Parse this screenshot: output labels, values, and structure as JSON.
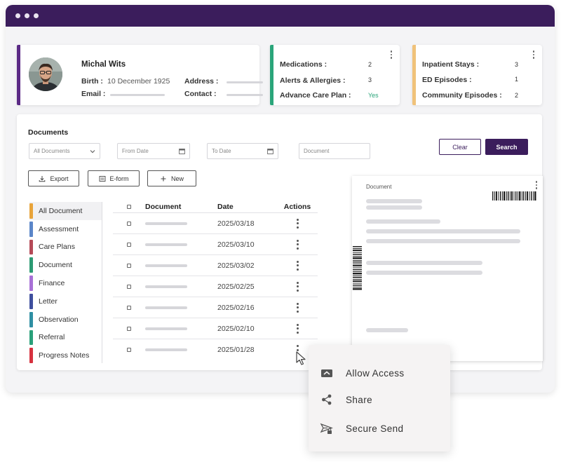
{
  "patient": {
    "name": "Michal Wits",
    "birth_label": "Birth :",
    "birth_value": "10 December 1925",
    "email_label": "Email :",
    "address_label": "Address :",
    "contact_label": "Contact :"
  },
  "clinical": {
    "rows": [
      {
        "label": "Medications :",
        "value": "2"
      },
      {
        "label": "Alerts & Allergies :",
        "value": "3"
      },
      {
        "label": "Advance Care Plan :",
        "value": "Yes"
      }
    ]
  },
  "episodes": {
    "rows": [
      {
        "label": "Inpatient Stays :",
        "value": "3"
      },
      {
        "label": "ED Episodes :",
        "value": "1"
      },
      {
        "label": "Community Episodes :",
        "value": "2"
      }
    ]
  },
  "documents": {
    "title": "Documents",
    "filter_select": "All Documents",
    "from_date_placeholder": "From Date",
    "to_date_placeholder": "To Date",
    "document_placeholder": "Document",
    "clear_label": "Clear",
    "search_label": "Search",
    "export_label": "Export",
    "eform_label": "E-form",
    "new_label": "New",
    "categories": [
      {
        "label": "All Document",
        "color": "#e8a43a"
      },
      {
        "label": "Assessment",
        "color": "#5b86c9"
      },
      {
        "label": "Care Plans",
        "color": "#b54a58"
      },
      {
        "label": "Document",
        "color": "#2c9a73"
      },
      {
        "label": "Finance",
        "color": "#a870d6"
      },
      {
        "label": "Letter",
        "color": "#3f4f9e"
      },
      {
        "label": "Observation",
        "color": "#2f8fa3"
      },
      {
        "label": "Referral",
        "color": "#2aa07a"
      },
      {
        "label": "Progress Notes",
        "color": "#d6323f"
      }
    ],
    "table": {
      "headers": {
        "document": "Document",
        "date": "Date",
        "actions": "Actions"
      },
      "rows": [
        {
          "date": "2025/03/18"
        },
        {
          "date": "2025/03/10"
        },
        {
          "date": "2025/03/02"
        },
        {
          "date": "2025/02/25"
        },
        {
          "date": "2025/02/16"
        },
        {
          "date": "2025/02/10"
        },
        {
          "date": "2025/01/28"
        }
      ]
    },
    "preview_title": "Document"
  },
  "context_menu": {
    "items": [
      {
        "label": "Allow Access",
        "icon": "allow-access-icon"
      },
      {
        "label": "Share",
        "icon": "share-icon"
      },
      {
        "label": "Secure Send",
        "icon": "secure-send-icon"
      }
    ]
  },
  "colors": {
    "brand": "#3b1d5c",
    "patient_accent": "#5b2a86",
    "clinical_accent": "#2aa57a",
    "episodes_accent": "#f0c27a",
    "yes_green": "#2aa57a"
  }
}
